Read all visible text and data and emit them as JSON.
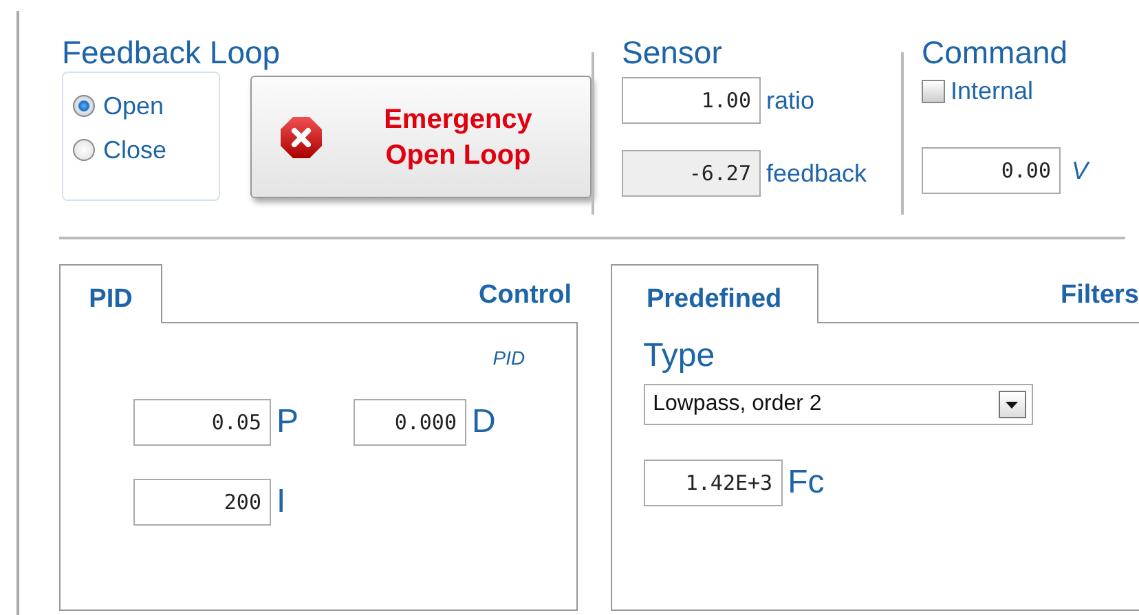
{
  "feedback_loop": {
    "title": "Feedback Loop",
    "options": [
      {
        "label": "Open",
        "selected": true
      },
      {
        "label": "Close",
        "selected": false
      }
    ],
    "emergency_button": {
      "label": "Emergency Open Loop"
    }
  },
  "sensor": {
    "title": "Sensor",
    "fields": [
      {
        "value": "1.00",
        "label": "ratio",
        "disabled": false
      },
      {
        "value": "-6.27",
        "label": "feedback",
        "disabled": true
      }
    ]
  },
  "command": {
    "title": "Command",
    "internal": {
      "label": "Internal",
      "checked": false
    },
    "field": {
      "value": "0.00",
      "unit": "V"
    }
  },
  "pid_panel": {
    "tab": {
      "label": "PID",
      "selected": true
    },
    "title": "Control",
    "note": "PID",
    "params": [
      {
        "value": "0.05",
        "label": "P"
      },
      {
        "value": "0.000",
        "label": "D"
      },
      {
        "value": "200",
        "label": "I"
      }
    ]
  },
  "filter_panel": {
    "tab": {
      "label": "Predefined",
      "selected": true
    },
    "title": "Filters",
    "type_label": "Type",
    "type_select": {
      "value": "Lowpass, order 2"
    },
    "cutoff": {
      "value": "1.42E+3",
      "label": "Fc"
    }
  }
}
